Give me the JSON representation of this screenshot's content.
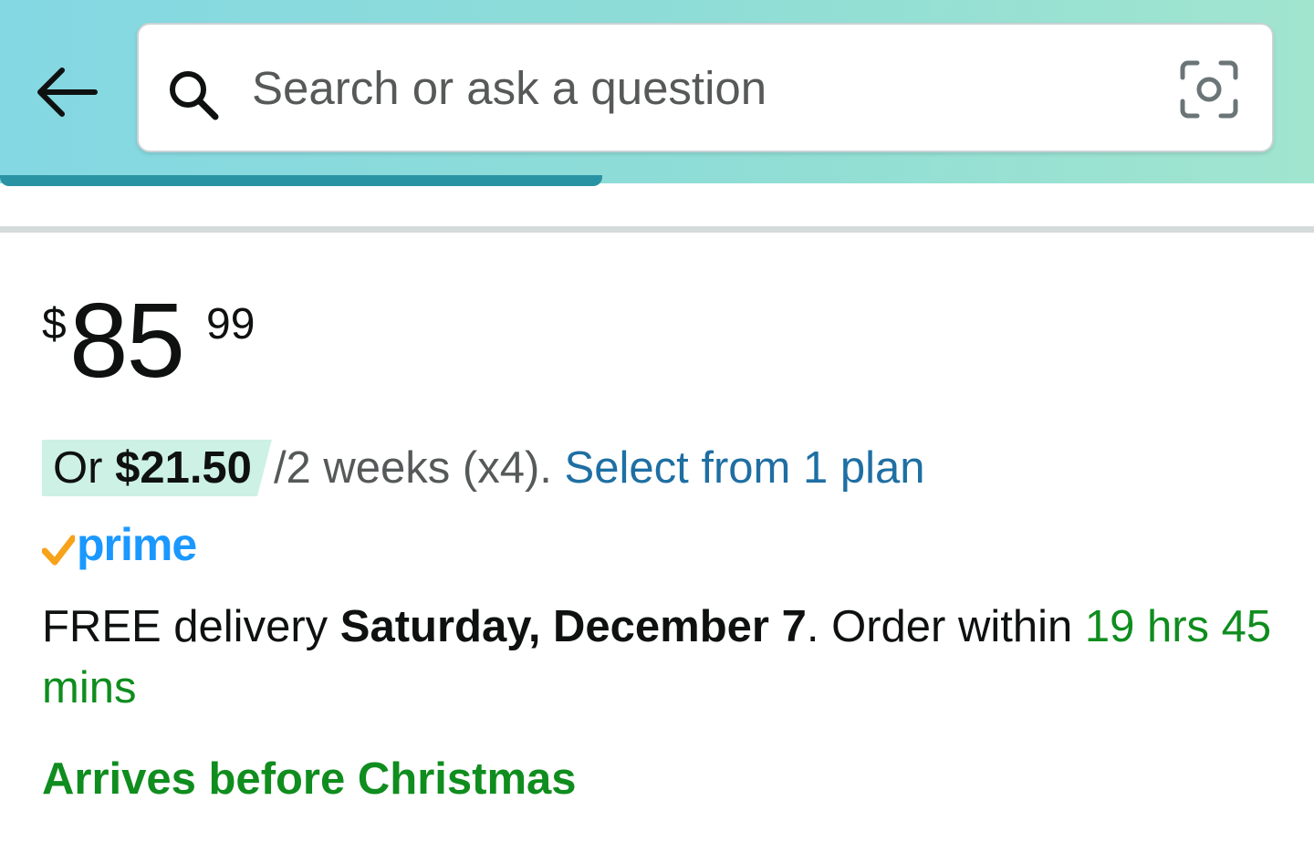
{
  "header": {
    "back_icon": "arrow-left-icon",
    "search": {
      "placeholder": "Search or ask a question",
      "search_icon": "search-icon",
      "camera_icon": "camera-lens-icon"
    },
    "gradient_colors": [
      "#84d8e3",
      "#a1e5cf"
    ]
  },
  "price": {
    "symbol": "$",
    "whole": "85",
    "fraction": "99"
  },
  "installment": {
    "prefix": "Or",
    "amount": "$21.50",
    "terms": "/2 weeks (x4).",
    "link": "Select from 1 plan",
    "highlight_color": "#cdf1e5",
    "link_color": "#1e6fa3"
  },
  "prime": {
    "label": "prime",
    "check_color": "#f7a21b",
    "text_color": "#1a98ff"
  },
  "delivery": {
    "prefix": "FREE delivery",
    "date": "Saturday, December 7",
    "middle": ". Order within",
    "countdown": "19 hrs 45 mins",
    "countdown_color": "#0f8d1e"
  },
  "badge": {
    "text": "Arrives before Christmas",
    "color": "#0f8d1e"
  }
}
